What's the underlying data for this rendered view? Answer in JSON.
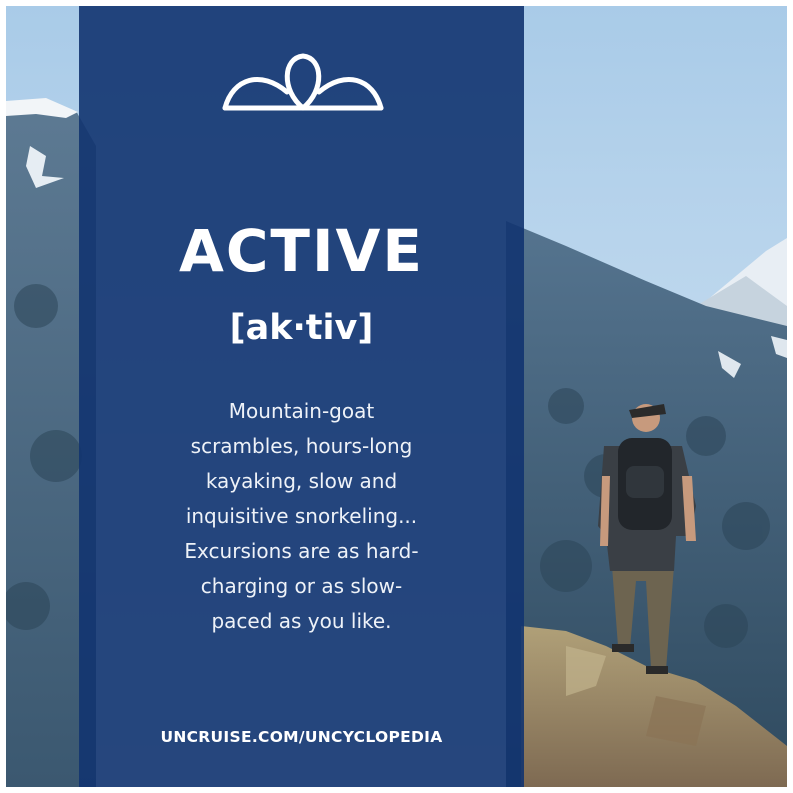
{
  "card": {
    "headword": "ACTIVE",
    "pronunciation": "[ak·tiv]",
    "description_lines": [
      "Mountain-goat",
      "scrambles, hours-long",
      "kayaking, slow and",
      "inquisitive snorkeling...",
      "Excursions are as hard-",
      "charging or as slow-",
      "paced as you like."
    ],
    "url": "UNCRUISE.COM/UNCYCLOPEDIA"
  },
  "colors": {
    "panel": "#123470",
    "text": "#ffffff",
    "sky": "#bcd6ee",
    "mountain": "#4c6a84",
    "rock": "#9c8a70"
  },
  "icons": [
    "uncruise-logo-icon"
  ]
}
